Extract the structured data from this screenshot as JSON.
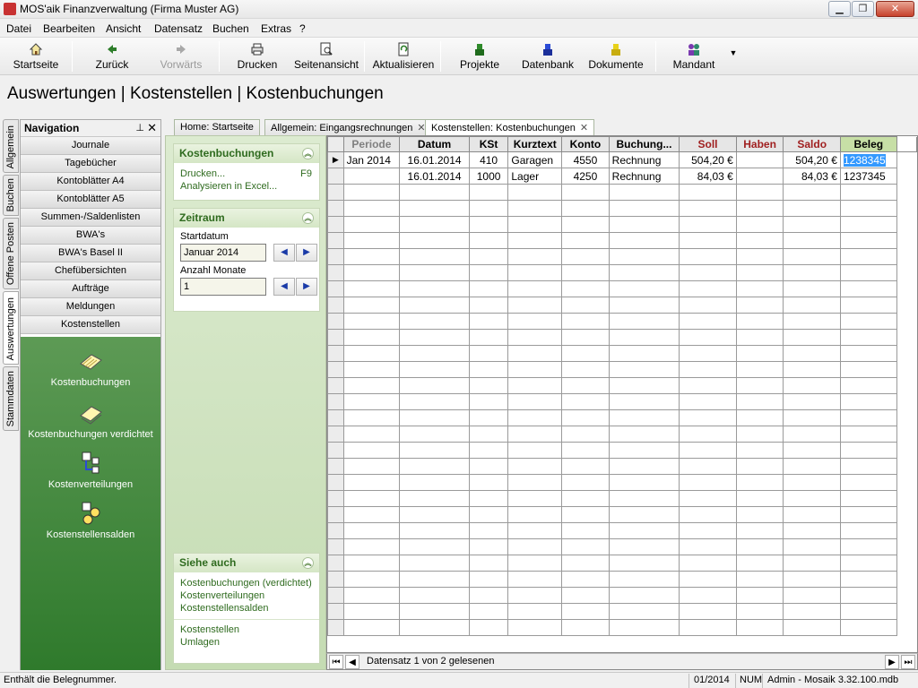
{
  "window": {
    "title": "MOS'aik Finanzverwaltung (Firma Muster AG)",
    "minimize": "▁",
    "restore": "❐",
    "close": "✕"
  },
  "menu": [
    {
      "label": "Datei"
    },
    {
      "label": "Bearbeiten"
    },
    {
      "label": "Ansicht"
    },
    {
      "label": "Datensatz"
    },
    {
      "label": "Buchen"
    },
    {
      "label": "Extras"
    },
    {
      "label": "?"
    }
  ],
  "toolbar": {
    "startseite": "Startseite",
    "zurueck": "Zurück",
    "vorwaerts": "Vorwärts",
    "drucken": "Drucken",
    "seitenansicht": "Seitenansicht",
    "aktualisieren": "Aktualisieren",
    "projekte": "Projekte",
    "datenbank": "Datenbank",
    "dokumente": "Dokumente",
    "mandant": "Mandant",
    "dropdown": "▼"
  },
  "breadcrumb": "Auswertungen | Kostenstellen | Kostenbuchungen",
  "sidetabs": [
    "Allgemein",
    "Buchen",
    "Offene Posten",
    "Auswertungen",
    "Stammdaten"
  ],
  "navigation": {
    "title": "Navigation",
    "pin": "📌",
    "close": "✕",
    "items": [
      "Journale",
      "Tagebücher",
      "Kontoblätter A4",
      "Kontoblätter A5",
      "Summen-/Saldenlisten",
      "BWA's",
      "BWA's Basel II",
      "Chefübersichten",
      "Aufträge",
      "Meldungen",
      "Kostenstellen"
    ],
    "big_items": [
      "Kostenbuchungen",
      "Kostenbuchungen verdichtet",
      "Kostenverteilungen",
      "Kostenstellensalden"
    ]
  },
  "taskpane": {
    "kostenbuchungen": {
      "title": "Kostenbuchungen",
      "drucken": "Drucken...",
      "drucken_key": "F9",
      "excel": "Analysieren in Excel..."
    },
    "zeitraum": {
      "title": "Zeitraum",
      "startdatum_label": "Startdatum",
      "startdatum_value": "Januar 2014",
      "monate_label": "Anzahl Monate",
      "monate_value": "1"
    },
    "siehe_auch": {
      "title": "Siehe auch",
      "links": [
        "Kostenbuchungen (verdichtet)",
        "Kostenverteilungen",
        "Kostenstellensalden",
        "Kostenstellen",
        "Umlagen"
      ]
    }
  },
  "doctabs": [
    "Home: Startseite",
    "Allgemein: Eingangsrechnungen",
    "Kostenstellen: Kostenbuchungen"
  ],
  "grid": {
    "columns": [
      "Periode",
      "Datum",
      "KSt",
      "Kurztext",
      "Konto",
      "Buchung...",
      "Soll",
      "Haben",
      "Saldo",
      "Beleg"
    ],
    "rows": [
      [
        "Jan 2014",
        "16.01.2014",
        "410",
        "Garagen",
        "4550",
        "Rechnung",
        "504,20 €",
        "",
        "504,20 €",
        "1238345"
      ],
      [
        "",
        "16.01.2014",
        "1000",
        "Lager",
        "4250",
        "Rechnung",
        "84,03 €",
        "",
        "84,03 €",
        "1237345"
      ]
    ]
  },
  "navbar": {
    "text": "Datensatz 1 von 2 gelesenen"
  },
  "status": {
    "message": "Enthält die Belegnummer.",
    "period": "01/2014",
    "num": "NUM",
    "user": "Admin - Mosaik 3.32.100.mdb"
  },
  "colors": {
    "nav_green": "#3f8a3a",
    "task_green": "#d5e6c5",
    "link_green": "#2f6b1f",
    "beleg_header": "#c7dfa6"
  }
}
